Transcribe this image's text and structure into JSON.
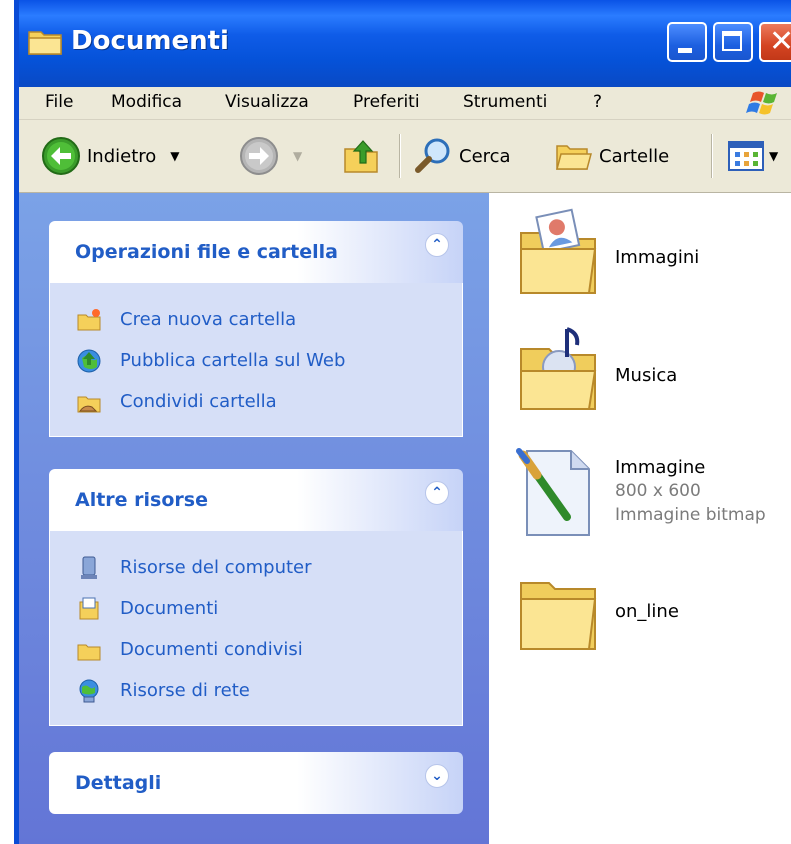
{
  "window": {
    "title": "Documenti",
    "title_icon": "folder-icon",
    "controls": [
      "minimize-button",
      "maximize-button",
      "close-button"
    ]
  },
  "menubar": {
    "items": [
      "File",
      "Modifica",
      "Visualizza",
      "Preferiti",
      "Strumenti",
      "?"
    ]
  },
  "toolbar": {
    "back_label": "Indietro",
    "search_label": "Cerca",
    "folders_label": "Cartelle"
  },
  "taskpane": {
    "file_tasks": {
      "title": "Operazioni file e cartella",
      "items": [
        "Crea nuova cartella",
        "Pubblica cartella sul Web",
        "Condividi cartella"
      ]
    },
    "other_places": {
      "title": "Altre risorse",
      "items": [
        "Risorse del computer",
        "Documenti",
        "Documenti condivisi",
        "Risorse di rete"
      ]
    },
    "details": {
      "title": "Dettagli"
    }
  },
  "files": [
    {
      "name": "Immagini",
      "icon": "pictures-folder-icon"
    },
    {
      "name": "Musica",
      "icon": "music-folder-icon"
    },
    {
      "name": "Immagine",
      "detail": "800 x 600",
      "type": "Immagine bitmap",
      "icon": "bitmap-image-icon"
    },
    {
      "name": "on_line",
      "icon": "folder-icon"
    }
  ],
  "colors": {
    "titlebar": "#0552d8",
    "taskpane_bg": "#6f8de0",
    "panel_title": "#215dc6",
    "panel_body": "#d6dff7"
  }
}
